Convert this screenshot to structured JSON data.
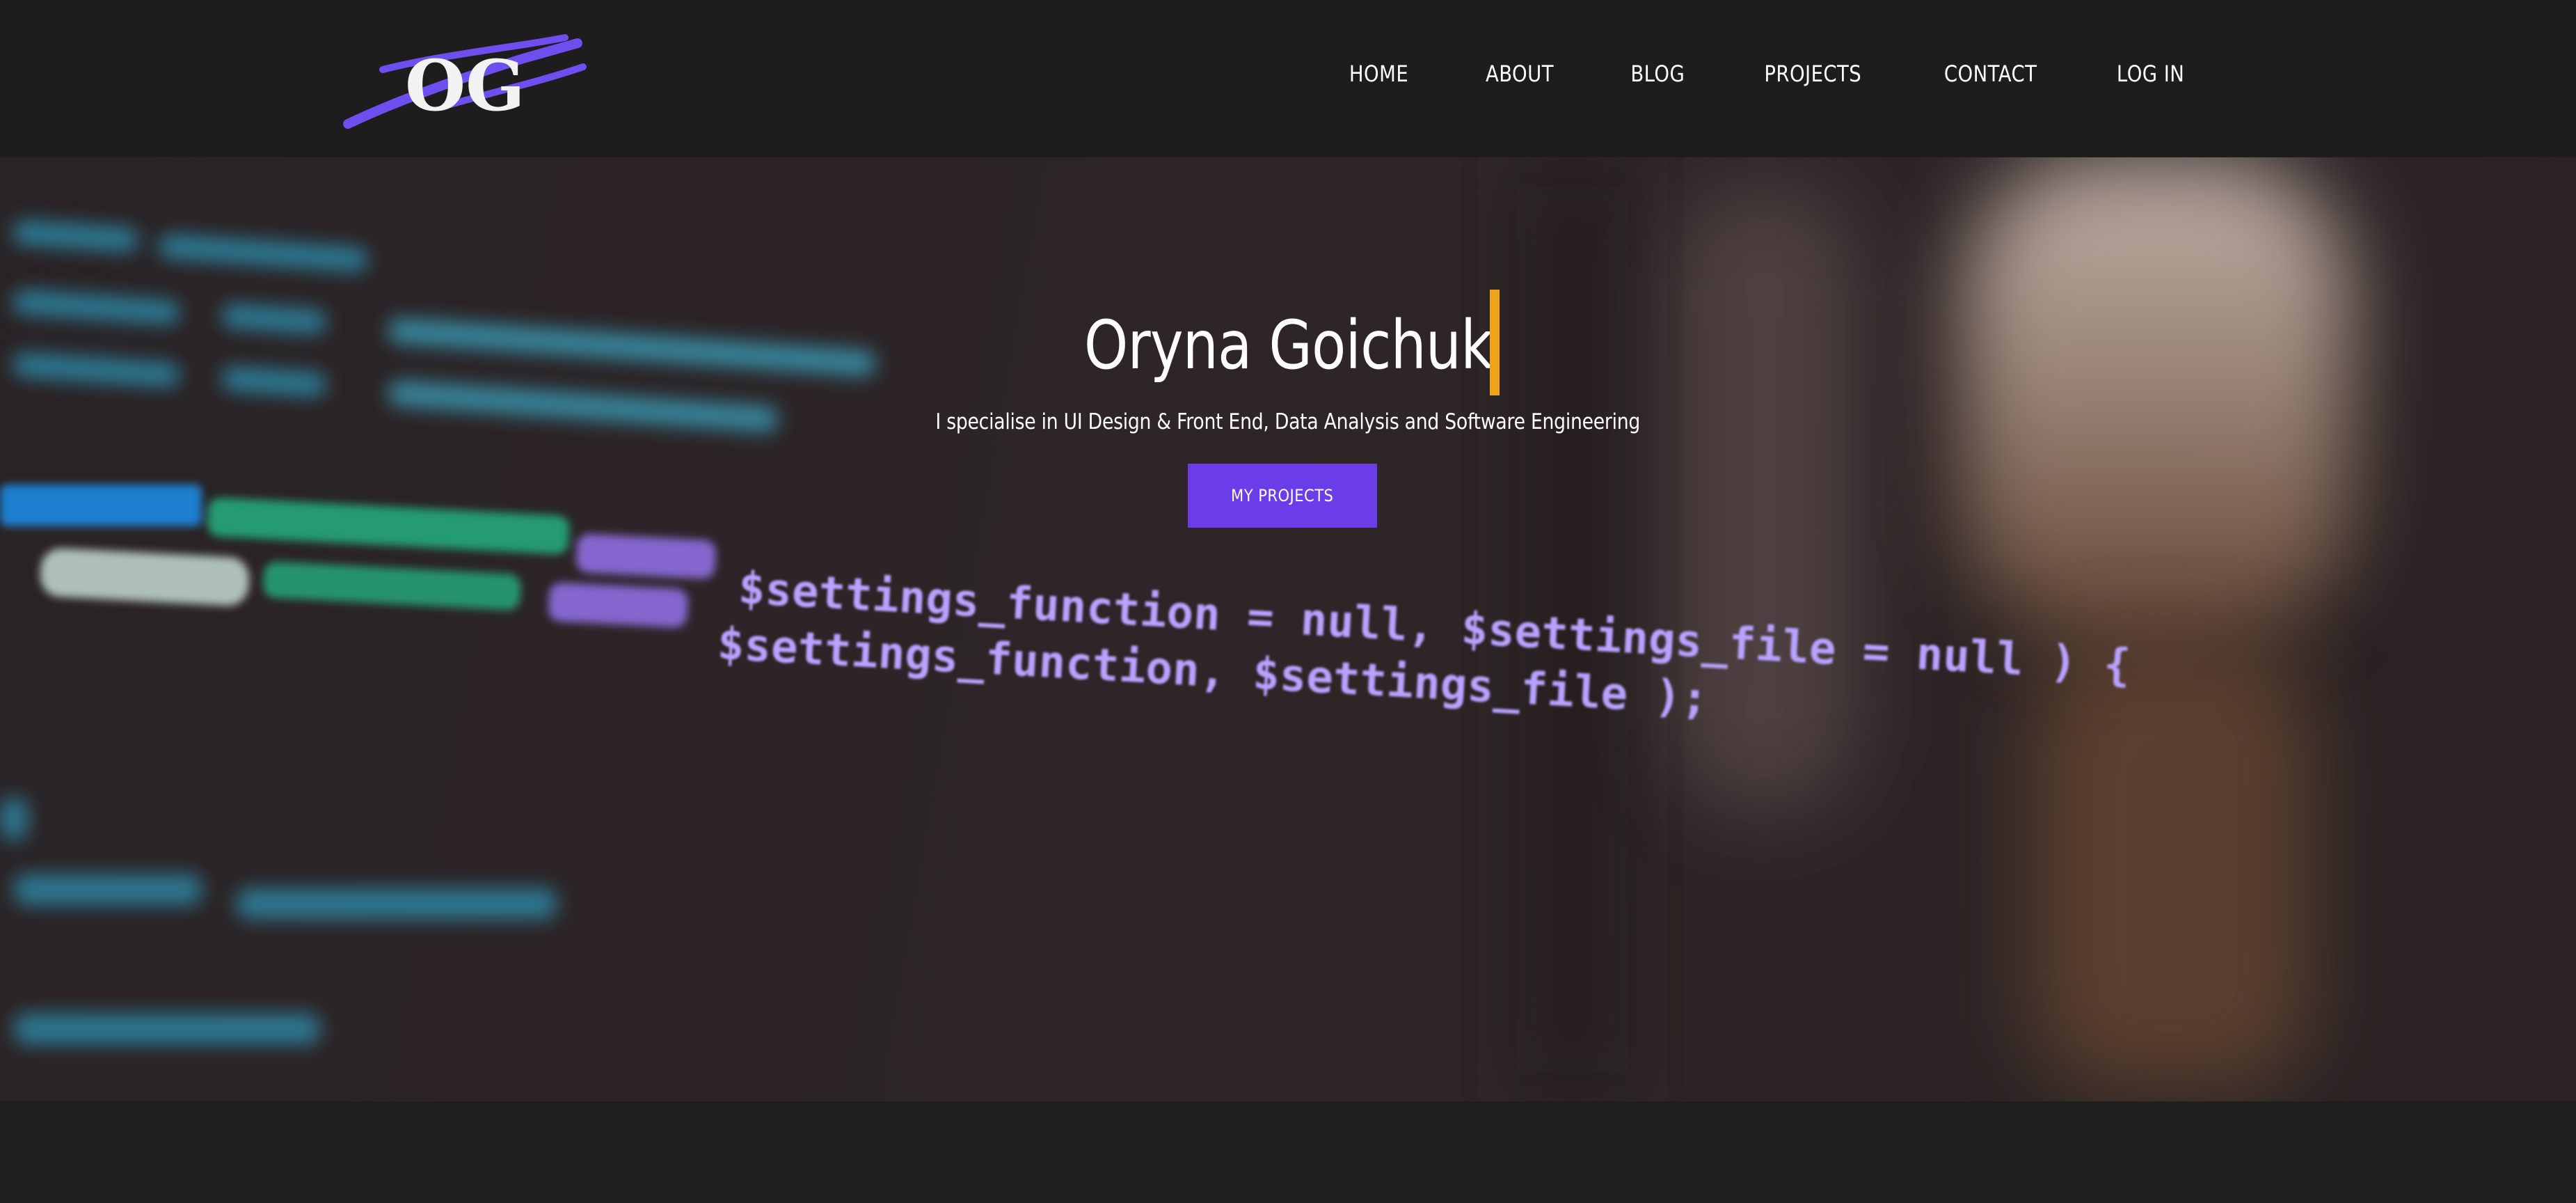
{
  "logo": {
    "text": "OG",
    "accent_color": "#6f4ef0"
  },
  "nav": {
    "items": [
      {
        "label": "HOME"
      },
      {
        "label": "ABOUT"
      },
      {
        "label": "BLOG"
      },
      {
        "label": "PROJECTS"
      },
      {
        "label": "CONTACT"
      },
      {
        "label": "LOG IN"
      }
    ]
  },
  "hero": {
    "title": "Oryna Goichuk",
    "subtitle": "I specialise in UI Design & Front End, Data Analysis and Software Engineering",
    "cta_label": "MY PROJECTS",
    "cursor_color": "#f0a21a",
    "button_color": "#6a3de8",
    "background_code_lines": [
      "$settings_function = null, $settings_file = null ) {",
      "$settings_function, $settings_file );"
    ]
  },
  "colors": {
    "header_bg": "#1d1d1d",
    "hero_bg": "#2d2527",
    "text": "#ffffff"
  }
}
